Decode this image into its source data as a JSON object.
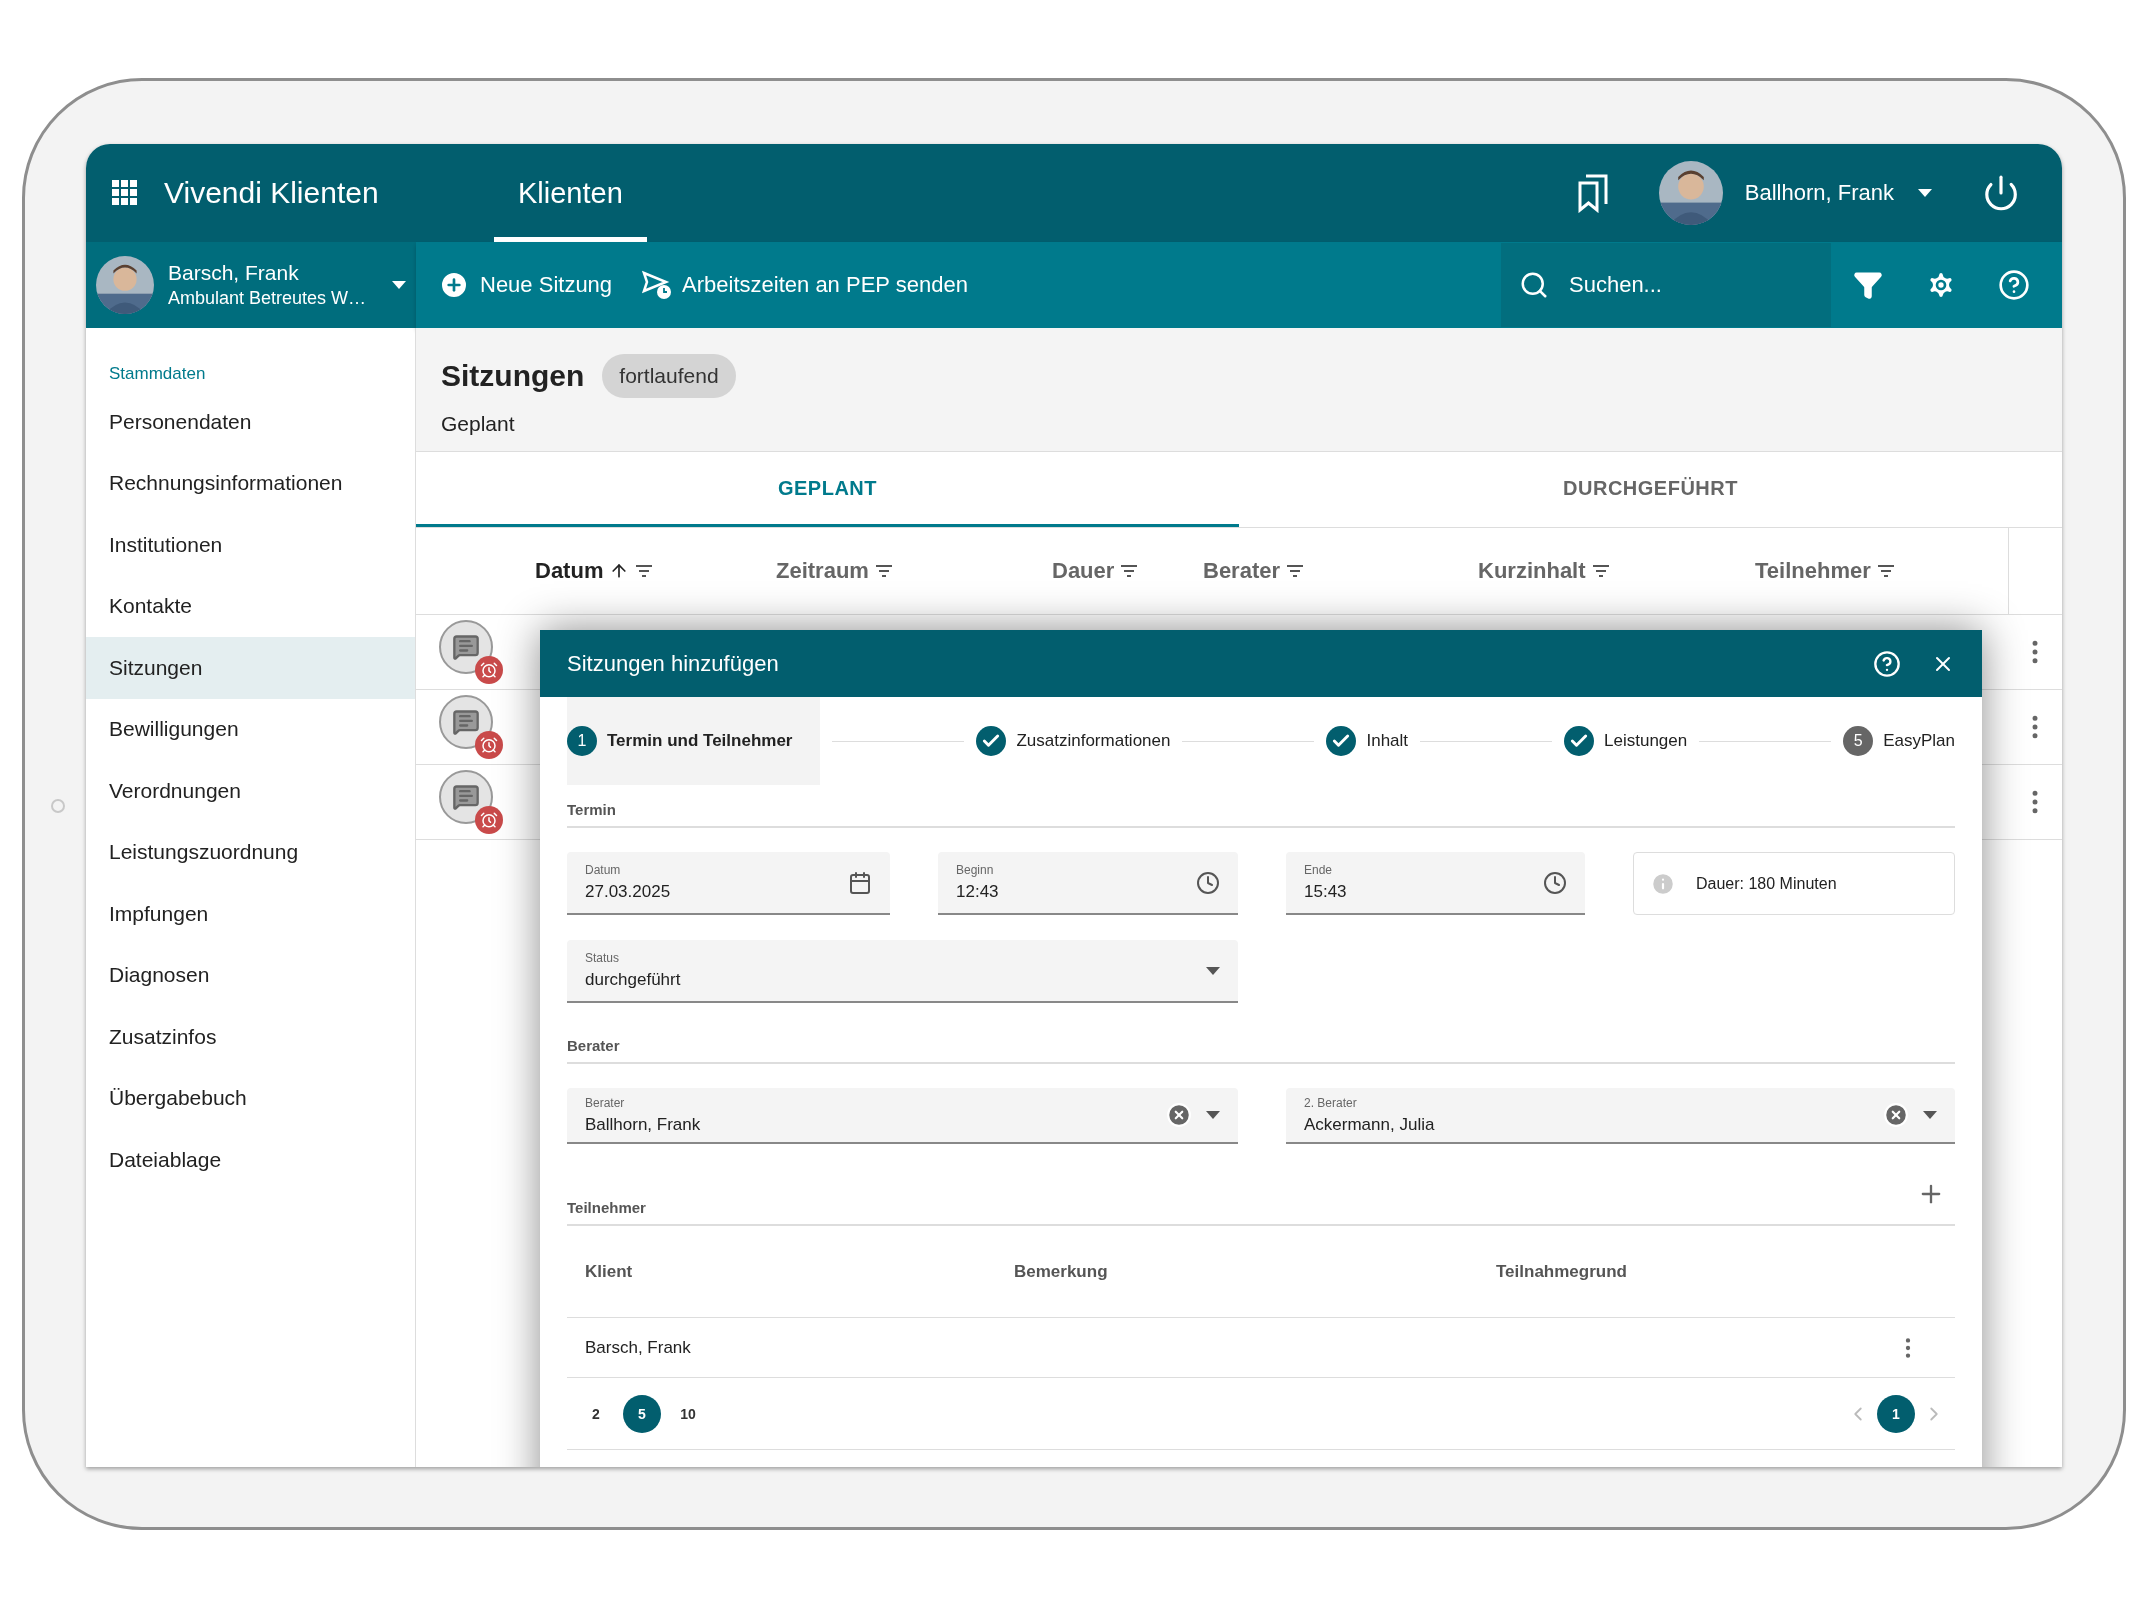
{
  "app": {
    "title": "Vivendi Klienten",
    "nav": [
      {
        "label": "Klienten",
        "selected": true
      }
    ],
    "user": {
      "name": "Ballhorn, Frank"
    }
  },
  "client": {
    "name": "Barsch, Frank",
    "subtitle": "Ambulant Betreutes W…"
  },
  "toolbar": {
    "actions": [
      {
        "kind": "add",
        "label": "Neue Sitzung"
      },
      {
        "kind": "send",
        "label": "Arbeitszeiten an PEP senden"
      }
    ],
    "search": {
      "placeholder": "Suchen..."
    }
  },
  "sidebar": {
    "section": "Stammdaten",
    "items": [
      {
        "label": "Personendaten",
        "selected": false
      },
      {
        "label": "Rechnungsinformationen",
        "selected": false
      },
      {
        "label": "Institutionen",
        "selected": false
      },
      {
        "label": "Kontakte",
        "selected": false
      },
      {
        "label": "Sitzungen",
        "selected": true
      },
      {
        "label": "Bewilligungen",
        "selected": false
      },
      {
        "label": "Verordnungen",
        "selected": false
      },
      {
        "label": "Leistungszuordnung",
        "selected": false
      },
      {
        "label": "Impfungen",
        "selected": false
      },
      {
        "label": "Diagnosen",
        "selected": false
      },
      {
        "label": "Zusatzinfos",
        "selected": false
      },
      {
        "label": "Übergabebuch",
        "selected": false
      },
      {
        "label": "Dateiablage",
        "selected": false
      }
    ]
  },
  "page": {
    "title": "Sitzungen",
    "badge": "fortlaufend",
    "subtitle": "Geplant"
  },
  "tabs": [
    {
      "label": "GEPLANT",
      "selected": true
    },
    {
      "label": "DURCHGEFÜHRT",
      "selected": false
    }
  ],
  "table": {
    "columns": [
      {
        "label": "Datum",
        "sorted": true
      },
      {
        "label": "Zeitraum",
        "sorted": false
      },
      {
        "label": "Dauer",
        "sorted": false
      },
      {
        "label": "Berater",
        "sorted": false
      },
      {
        "label": "Kurzinhalt",
        "sorted": false
      },
      {
        "label": "Teilnehmer",
        "sorted": false
      }
    ],
    "rows": [
      {
        "kind": "session"
      },
      {
        "kind": "session"
      },
      {
        "kind": "session"
      }
    ]
  },
  "dialog": {
    "title": "Sitzungen hinzufügen",
    "steps": [
      {
        "kind": "number",
        "number": "1",
        "label": "Termin und Teilnehmer",
        "selected": true
      },
      {
        "kind": "done",
        "label": "Zusatzinformationen",
        "selected": false
      },
      {
        "kind": "done",
        "label": "Inhalt",
        "selected": false
      },
      {
        "kind": "done",
        "label": "Leistungen",
        "selected": false
      },
      {
        "kind": "number",
        "number": "5",
        "label": "EasyPlan",
        "selected": false
      }
    ],
    "termin": {
      "heading": "Termin",
      "fields": [
        {
          "kind": "date",
          "label": "Datum",
          "value": "27.03.2025"
        },
        {
          "kind": "time",
          "label": "Beginn",
          "value": "12:43"
        },
        {
          "kind": "time",
          "label": "Ende",
          "value": "15:43"
        }
      ],
      "info": "Dauer: 180 Minuten",
      "status": {
        "label": "Status",
        "value": "durchgeführt"
      }
    },
    "berater": {
      "heading": "Berater",
      "fields": [
        {
          "label": "Berater",
          "value": "Ballhorn, Frank"
        },
        {
          "label": "2. Berater",
          "value": "Ackermann, Julia"
        }
      ]
    },
    "teilnehmer": {
      "heading": "Teilnehmer",
      "columns": [
        "Klient",
        "Bemerkung",
        "Teilnahmegrund"
      ],
      "rows": [
        {
          "klient": "Barsch, Frank"
        }
      ],
      "page_sizes": [
        {
          "label": "2",
          "selected": false
        },
        {
          "label": "5",
          "selected": true
        },
        {
          "label": "10",
          "selected": false
        }
      ],
      "pages": [
        {
          "label": "1",
          "selected": true
        }
      ]
    }
  }
}
